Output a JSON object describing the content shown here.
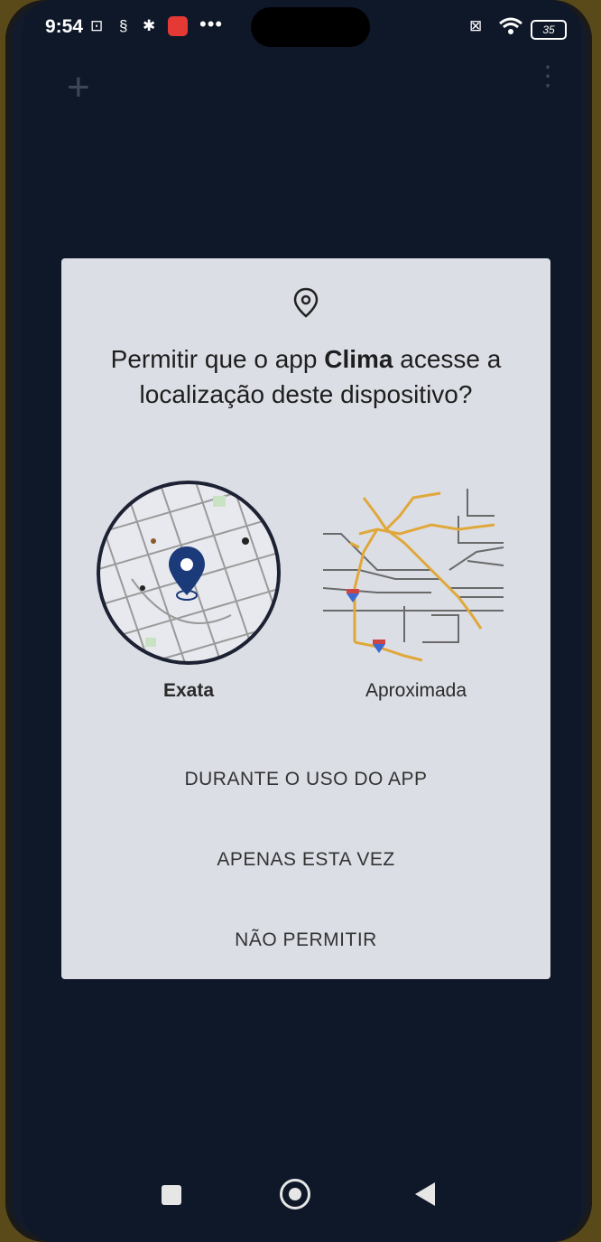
{
  "status_bar": {
    "time": "9:54",
    "battery": "35"
  },
  "dialog": {
    "title_prefix": "Permitir que o app ",
    "app_name": "Clima",
    "title_suffix": " acesse a localização deste dispositivo?",
    "precise_label": "Exata",
    "approximate_label": "Aproximada",
    "actions": [
      "DURANTE O USO DO APP",
      "APENAS ESTA VEZ",
      "NÃO PERMITIR"
    ]
  },
  "colors": {
    "dialog_bg": "#dcdee6",
    "pin": "#1b3a7a",
    "map_roads": "#e0a83a"
  }
}
